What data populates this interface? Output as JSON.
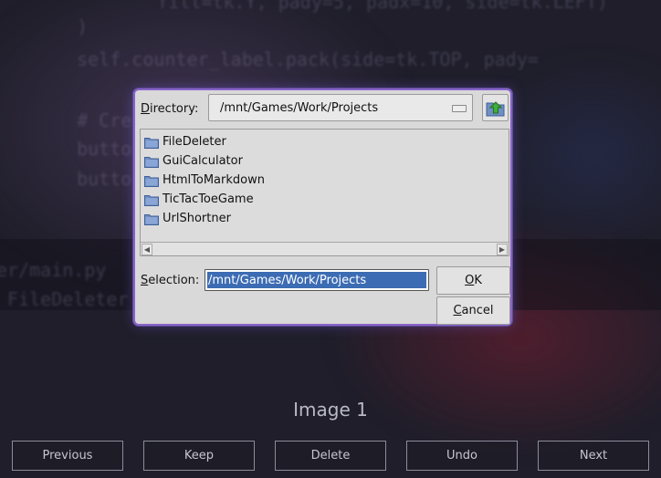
{
  "background": {
    "code_lines": [
      "      fill=tk.Y, pady=5, padx=10, side=tk.LEFT)",
      "  )",
      "  self.counter_label.pack(side=tk.TOP, pady=",
      "  # Create a Browse button",
      "  button",
      "  button.pack(side=tk.BOTTOM, fill=tk.",
      "er/main.py",
      " FileDeleter"
    ]
  },
  "dialog": {
    "directory_label": "Directory:",
    "directory_accel": "D",
    "directory_rest": "irectory:",
    "directory_value": "/mnt/Games/Work/Projects",
    "up_folder_icon": "folder-up-icon",
    "items": [
      {
        "label": "FileDeleter"
      },
      {
        "label": "GuiCalculator"
      },
      {
        "label": "HtmlToMarkdown"
      },
      {
        "label": "TicTacToeGame"
      },
      {
        "label": "UrlShortner"
      }
    ],
    "selection_accel": "S",
    "selection_rest": "election:",
    "selection_value": "/mnt/Games/Work/Projects",
    "ok_accel": "O",
    "ok_rest": "K",
    "cancel_accel": "C",
    "cancel_rest": "ancel"
  },
  "image_label": "Image 1",
  "nav": {
    "previous": "Previous",
    "keep": "Keep",
    "delete": "Delete",
    "undo": "Undo",
    "next": "Next"
  },
  "colors": {
    "accent": "#8a63c7",
    "selection_bg": "#3c6cb3",
    "folder": "#5f7fb7"
  }
}
